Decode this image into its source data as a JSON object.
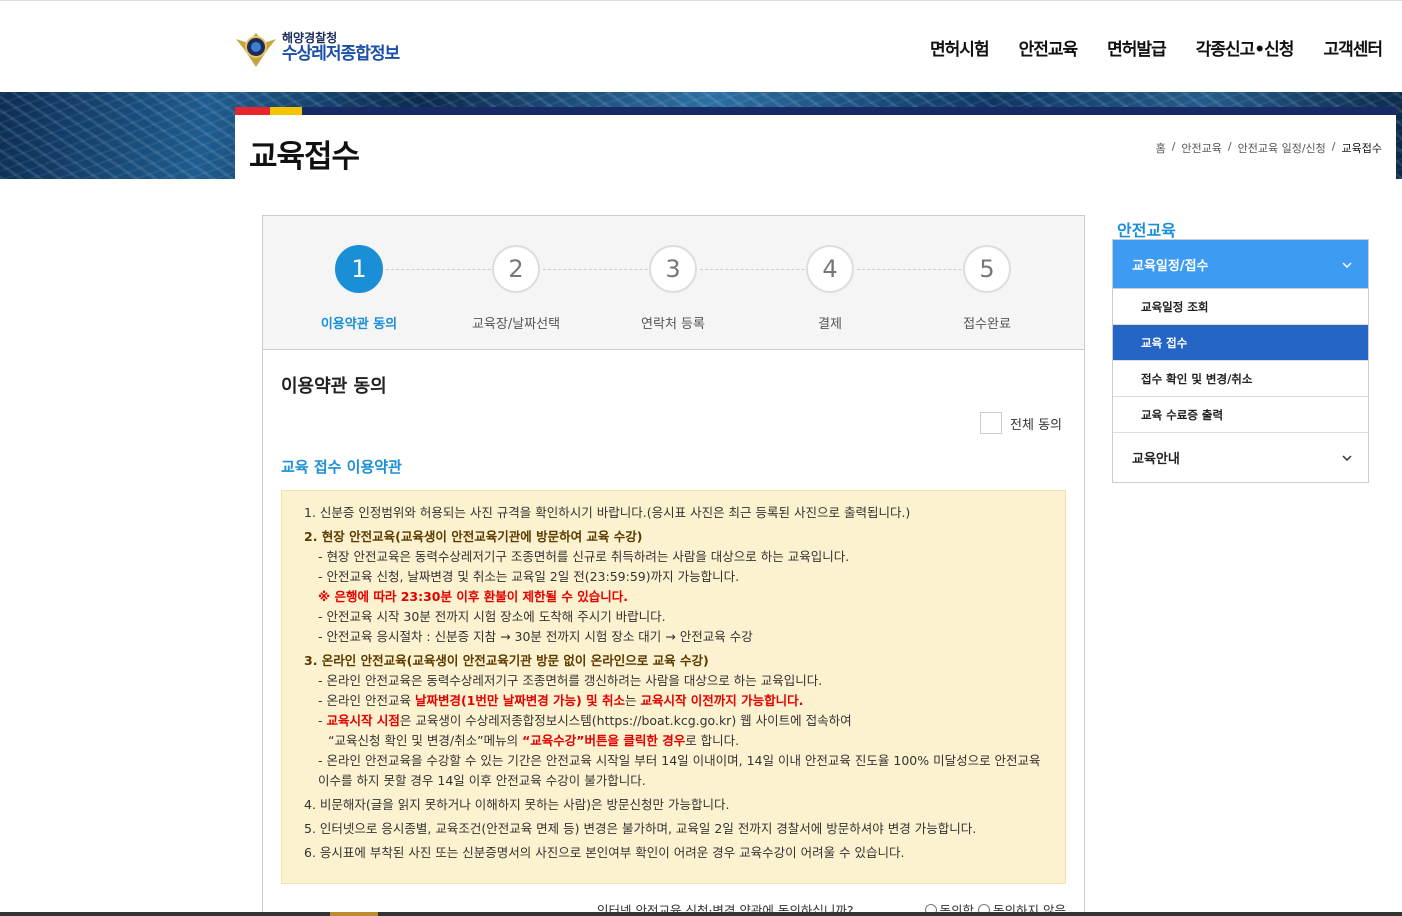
{
  "header": {
    "logo_small": "해양경찰청",
    "logo_big": "수상레저종합정보",
    "nav": [
      "면허시험",
      "안전교육",
      "면허발급",
      "각종신고•신청",
      "고객센터"
    ]
  },
  "page": {
    "title": "교육접수",
    "breadcrumb": [
      "홈",
      "안전교육",
      "안전교육 일정/신청",
      "교육접수"
    ]
  },
  "steps": [
    {
      "num": "1",
      "label": "이용약관 동의"
    },
    {
      "num": "2",
      "label": "교육장/날짜선택"
    },
    {
      "num": "3",
      "label": "연락처 등록"
    },
    {
      "num": "4",
      "label": "결제"
    },
    {
      "num": "5",
      "label": "접수완료"
    }
  ],
  "section_title": "이용약관 동의",
  "agree_all_label": "전체 동의",
  "terms_title": "교육 접수 이용약관",
  "terms": {
    "t1": "1. 신분증 인정범위와 허용되는 사진 규격을 확인하시기 바랍니다.(응시표 사진은 최근 등록된 사진으로 출력됩니다.)",
    "t2": "2. 현장 안전교육(교육생이 안전교육기관에 방문하여 교육 수강)",
    "t2a": "- 현장 안전교육은 동력수상레저기구 조종면허를 신규로 취득하려는 사람을 대상으로 하는 교육입니다.",
    "t2b": "- 안전교육 신청, 날짜변경 및 취소는 교육일 2일 전(23:59:59)까지 가능합니다.",
    "t2c": "※ 은행에 따라 23:30분 이후 환불이 제한될 수 있습니다.",
    "t2d": "- 안전교육 시작 30분 전까지 시험 장소에 도착해 주시기 바랍니다.",
    "t2e": "- 안전교육 응시절차 : 신분증 지참 → 30분 전까지 시험 장소 대기 → 안전교육 수강",
    "t3": "3. 온라인 안전교육(교육생이 안전교육기관 방문 없이 온라인으로 교육 수강)",
    "t3a": "- 온라인 안전교육은 동력수상레저기구 조종면허를 갱신하려는 사람을 대상으로 하는 교육입니다.",
    "t3b_1": "- 온라인 안전교육 ",
    "t3b_2": "날짜변경(1번만 날짜변경 가능) 및 취소",
    "t3b_3": "는 ",
    "t3b_4": "교육시작 이전까지 가능합니다.",
    "t3c_1": "- ",
    "t3c_2": "교육시작 시점",
    "t3c_3": "은 교육생이 수상레저종합정보시스템(https://boat.kcg.go.kr) 웹 사이트에 접속하여",
    "t3c_4": "“교육신청 확인 및 변경/취소”메뉴의 ",
    "t3c_5": "“교육수강”버튼을 클릭한 경우",
    "t3c_6": "로 합니다.",
    "t3d": "- 온라인 안전교육을 수강할 수 있는 기간은 안전교육 시작일 부터 14일 이내이며, 14일 이내 안전교육 진도율 100% 미달성으로 안전교육 이수를 하지 못할 경우 14일 이후 안전교육 수강이 불가합니다.",
    "t4": "4. 비문해자(글을 읽지 못하거나 이해하지 못하는 사람)은 방문신청만 가능합니다.",
    "t5": "5. 인터넷으로 응시종별, 교육조건(안전교육 면제 등) 변경은 불가하며, 교육일 2일 전까지 경찰서에 방문하셔야 변경 가능합니다.",
    "t6": "6. 응시표에 부착된 사진 또는 신분증명서의 사진으로 본인여부 확인이 어려운 경우 교육수강이 어려울 수 있습니다."
  },
  "agree_question": "인터넷 안전교육 신청·변경 약관에 동의하십니까?",
  "agree_yes": "동의함",
  "agree_no": "동의하지 않음",
  "sidebar": {
    "title": "안전교육",
    "group1": "교육일정/접수",
    "items": [
      "교육일정 조회",
      "교육 접수",
      "접수 확인 및 변경/취소",
      "교육 수료증 출력"
    ],
    "group2": "교육안내"
  },
  "icons": {
    "chevron": "chevron-down-icon",
    "emblem": "police-emblem-icon"
  },
  "colors": {
    "accent": "#1a8fd6",
    "nav_active": "#3d9bf2",
    "sub_active": "#2565c6",
    "warn": "#e30000",
    "terms_bg": "#fdf2cf"
  }
}
